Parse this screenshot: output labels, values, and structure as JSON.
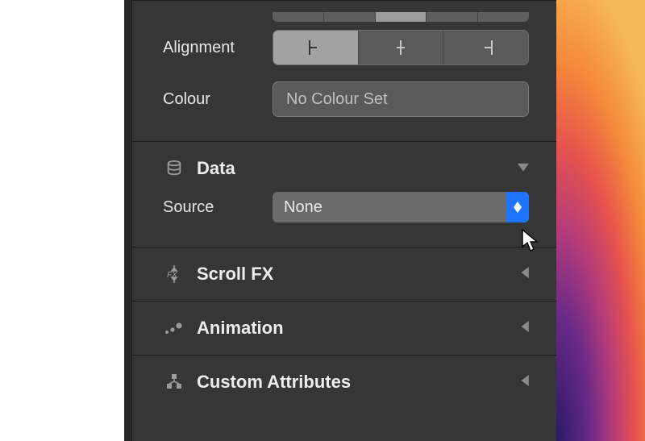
{
  "top_clipped_segment": {
    "selected_index": 2
  },
  "alignment": {
    "label": "Alignment",
    "options": [
      "left",
      "center",
      "right"
    ],
    "selected_index": 0
  },
  "colour": {
    "label": "Colour",
    "value": "No Colour Set"
  },
  "data_section": {
    "title": "Data",
    "expanded": true,
    "source": {
      "label": "Source",
      "value": "None"
    }
  },
  "sections": {
    "scroll_fx": {
      "title": "Scroll FX",
      "expanded": false
    },
    "animation": {
      "title": "Animation",
      "expanded": false
    },
    "custom_attributes": {
      "title": "Custom Attributes",
      "expanded": false
    }
  }
}
